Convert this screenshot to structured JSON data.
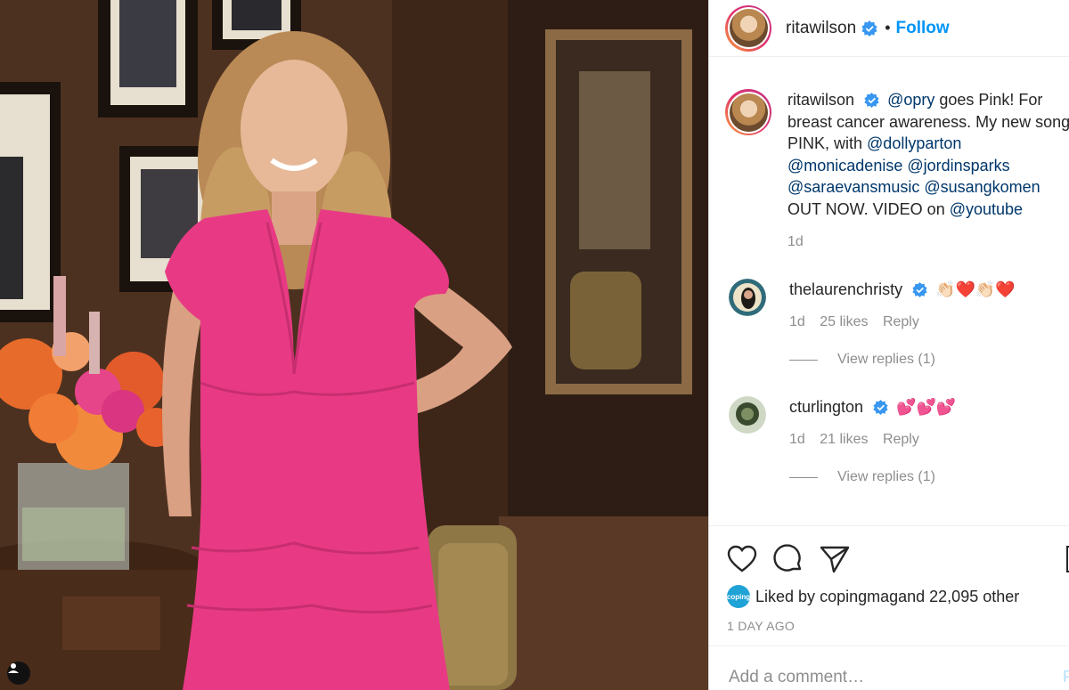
{
  "post": {
    "author": "ritawilson",
    "follow_label": "Follow",
    "separator": "•",
    "caption": {
      "username": "ritawilson",
      "text_parts": [
        {
          "type": "mention",
          "text": "@opry"
        },
        {
          "type": "text",
          "text": " goes Pink! For breast cancer awareness. My new song PINK, with "
        },
        {
          "type": "mention",
          "text": "@dollyparton"
        },
        {
          "type": "text",
          "text": " "
        },
        {
          "type": "mention",
          "text": "@monicadenise"
        },
        {
          "type": "text",
          "text": " "
        },
        {
          "type": "mention",
          "text": "@jordinsparks"
        },
        {
          "type": "text",
          "text": " "
        },
        {
          "type": "mention",
          "text": "@saraevansmusic"
        },
        {
          "type": "text",
          "text": " "
        },
        {
          "type": "mention",
          "text": "@susangkomen"
        },
        {
          "type": "text",
          "text": " OUT NOW. VIDEO on "
        },
        {
          "type": "mention",
          "text": "@youtube"
        }
      ],
      "age": "1d"
    },
    "comments": [
      {
        "username": "thelaurenchristy",
        "text": "👏🏻❤️👏🏻❤️",
        "age": "1d",
        "likes": "25 likes",
        "reply_label": "Reply",
        "view_replies": "View replies (1)"
      },
      {
        "username": "cturlington",
        "text": "💕💕💕",
        "age": "1d",
        "likes": "21 likes",
        "reply_label": "Reply",
        "view_replies": "View replies (1)"
      }
    ],
    "liked_by_prefix": "Liked by ",
    "liked_by_user": "copingmag",
    "liked_by_suffix": " and 22,095 other",
    "liked_avatar_text": "coping",
    "timestamp": "1 DAY AGO",
    "add_comment_placeholder": "Add a comment…",
    "post_label": "P"
  },
  "icons": {
    "like": "heart-icon",
    "comment": "comment-bubble-icon",
    "share": "paper-plane-icon",
    "save": "bookmark-icon",
    "verified": "verified-badge-icon"
  },
  "colors": {
    "follow": "#0095f6",
    "verified": "#3897f0",
    "mention": "#00376b",
    "muted": "#8e8e8e",
    "dress": "#e83a84"
  }
}
